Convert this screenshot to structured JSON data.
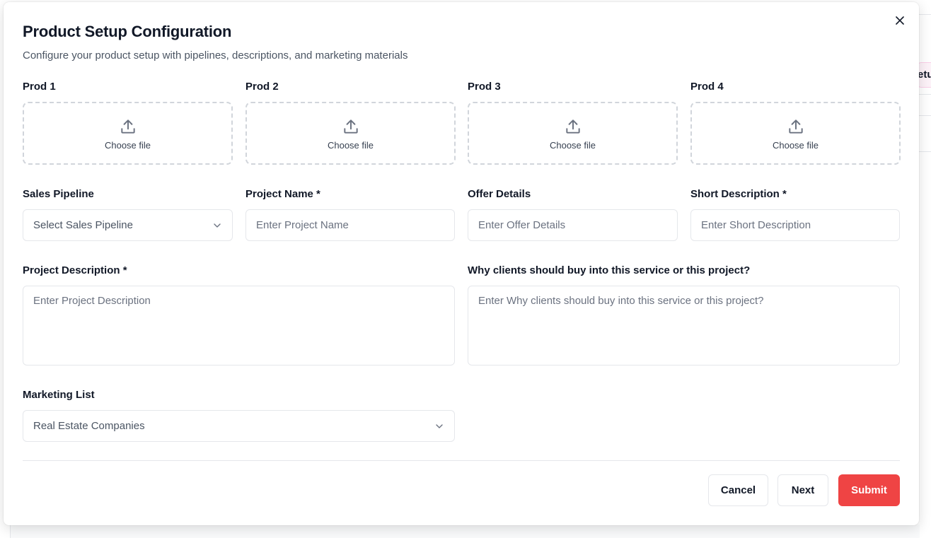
{
  "background": {
    "edge_text": "etu"
  },
  "modal": {
    "title": "Product Setup Configuration",
    "subtitle": "Configure your product setup with pipelines, descriptions, and marketing materials",
    "close_icon": "close-icon"
  },
  "uploads": [
    {
      "label": "Prod 1",
      "button_text": "Choose file",
      "icon": "upload-icon"
    },
    {
      "label": "Prod 2",
      "button_text": "Choose file",
      "icon": "upload-icon"
    },
    {
      "label": "Prod 3",
      "button_text": "Choose file",
      "icon": "upload-icon"
    },
    {
      "label": "Prod 4",
      "button_text": "Choose file",
      "icon": "upload-icon"
    }
  ],
  "fields": {
    "sales_pipeline": {
      "label": "Sales Pipeline",
      "placeholder": "Select Sales Pipeline",
      "icon": "chevron-down-icon"
    },
    "project_name": {
      "label": "Project Name *",
      "placeholder": "Enter Project Name",
      "value": ""
    },
    "offer_details": {
      "label": "Offer Details",
      "placeholder": "Enter Offer Details",
      "value": ""
    },
    "short_description": {
      "label": "Short Description *",
      "placeholder": "Enter Short Description",
      "value": ""
    },
    "project_description": {
      "label": "Project Description *",
      "placeholder": "Enter Project Description",
      "value": ""
    },
    "why_clients": {
      "label": "Why clients should buy into this service or this project?",
      "placeholder": "Enter Why clients should buy into this service or this project?",
      "value": ""
    },
    "marketing_list": {
      "label": "Marketing List",
      "selected": "Real Estate Companies",
      "icon": "chevron-down-icon"
    }
  },
  "actions": {
    "cancel_label": "Cancel",
    "next_label": "Next",
    "submit_label": "Submit"
  },
  "colors": {
    "primary": "#ef4444",
    "border": "#e5e7eb",
    "dashed_border": "#d1d5db",
    "text": "#111827",
    "muted": "#6b7280"
  }
}
